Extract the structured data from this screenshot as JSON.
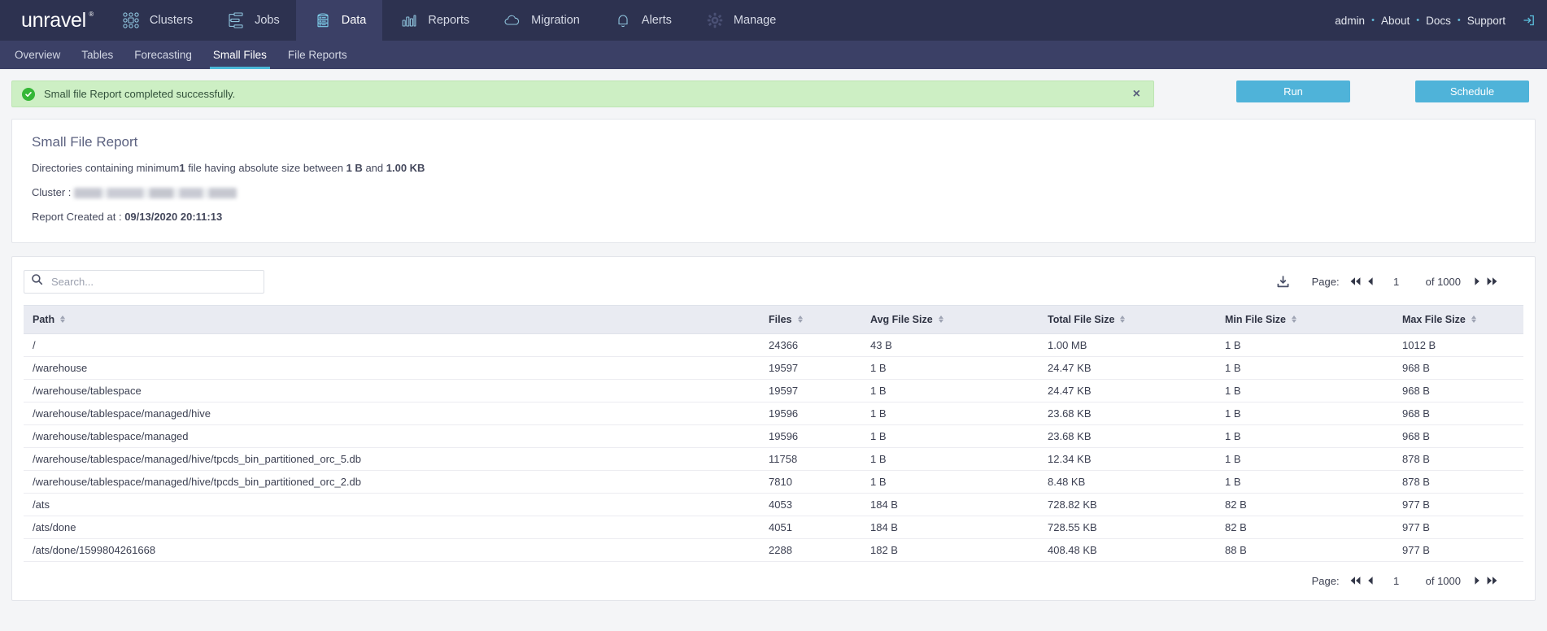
{
  "topnav": {
    "logo": "unravel",
    "items": [
      {
        "label": "Clusters",
        "icon": "clusters-icon",
        "active": false
      },
      {
        "label": "Jobs",
        "icon": "jobs-icon",
        "active": false
      },
      {
        "label": "Data",
        "icon": "data-icon",
        "active": true
      },
      {
        "label": "Reports",
        "icon": "reports-icon",
        "active": false
      },
      {
        "label": "Migration",
        "icon": "migration-icon",
        "active": false
      },
      {
        "label": "Alerts",
        "icon": "alerts-icon",
        "active": false
      },
      {
        "label": "Manage",
        "icon": "manage-icon",
        "active": false
      }
    ],
    "right_links": [
      "admin",
      "About",
      "Docs",
      "Support"
    ],
    "separator": "•",
    "logout_icon": "logout-icon"
  },
  "subnav": {
    "items": [
      {
        "label": "Overview",
        "active": false
      },
      {
        "label": "Tables",
        "active": false
      },
      {
        "label": "Forecasting",
        "active": false
      },
      {
        "label": "Small Files",
        "active": true
      },
      {
        "label": "File Reports",
        "active": false
      }
    ]
  },
  "alert": {
    "message": "Small file Report completed successfully.",
    "close_label": "×",
    "icon": "check-circle-icon",
    "background": "#cdefc4"
  },
  "actions": {
    "run_label": "Run",
    "schedule_label": "Schedule",
    "accent": "#4fb3d9"
  },
  "report": {
    "title": "Small File Report",
    "description_prefix": "Directories containing minimum",
    "min_files": "1",
    "description_mid": " file having absolute size between ",
    "size_min": "1 B",
    "description_and": " and ",
    "size_max": "1.00 KB",
    "cluster_label": "Cluster :",
    "cluster_value": "",
    "created_label": "Report Created at :",
    "created_value": "09/13/2020 20:11:13"
  },
  "search": {
    "placeholder": "Search...",
    "value": "",
    "icon": "search-icon"
  },
  "pagination": {
    "label": "Page:",
    "current": "1",
    "of_text": "of 1000",
    "first_icon": "first-page-icon",
    "prev_icon": "prev-page-icon",
    "next_icon": "next-page-icon",
    "last_icon": "last-page-icon",
    "download_icon": "download-icon"
  },
  "table": {
    "columns": [
      {
        "label": "Path",
        "key": "path"
      },
      {
        "label": "Files",
        "key": "files"
      },
      {
        "label": "Avg File Size",
        "key": "avg"
      },
      {
        "label": "Total File Size",
        "key": "total"
      },
      {
        "label": "Min File Size",
        "key": "min"
      },
      {
        "label": "Max File Size",
        "key": "max"
      }
    ],
    "rows": [
      {
        "path": "/",
        "files": "24366",
        "avg": "43 B",
        "total": "1.00 MB",
        "min": "1 B",
        "max": "1012 B"
      },
      {
        "path": "/warehouse",
        "files": "19597",
        "avg": "1 B",
        "total": "24.47 KB",
        "min": "1 B",
        "max": "968 B"
      },
      {
        "path": "/warehouse/tablespace",
        "files": "19597",
        "avg": "1 B",
        "total": "24.47 KB",
        "min": "1 B",
        "max": "968 B"
      },
      {
        "path": "/warehouse/tablespace/managed/hive",
        "files": "19596",
        "avg": "1 B",
        "total": "23.68 KB",
        "min": "1 B",
        "max": "968 B"
      },
      {
        "path": "/warehouse/tablespace/managed",
        "files": "19596",
        "avg": "1 B",
        "total": "23.68 KB",
        "min": "1 B",
        "max": "968 B"
      },
      {
        "path": "/warehouse/tablespace/managed/hive/tpcds_bin_partitioned_orc_5.db",
        "files": "11758",
        "avg": "1 B",
        "total": "12.34 KB",
        "min": "1 B",
        "max": "878 B"
      },
      {
        "path": "/warehouse/tablespace/managed/hive/tpcds_bin_partitioned_orc_2.db",
        "files": "7810",
        "avg": "1 B",
        "total": "8.48 KB",
        "min": "1 B",
        "max": "878 B"
      },
      {
        "path": "/ats",
        "files": "4053",
        "avg": "184 B",
        "total": "728.82 KB",
        "min": "82 B",
        "max": "977 B"
      },
      {
        "path": "/ats/done",
        "files": "4051",
        "avg": "184 B",
        "total": "728.55 KB",
        "min": "82 B",
        "max": "977 B"
      },
      {
        "path": "/ats/done/1599804261668",
        "files": "2288",
        "avg": "182 B",
        "total": "408.48 KB",
        "min": "88 B",
        "max": "977 B"
      }
    ]
  }
}
